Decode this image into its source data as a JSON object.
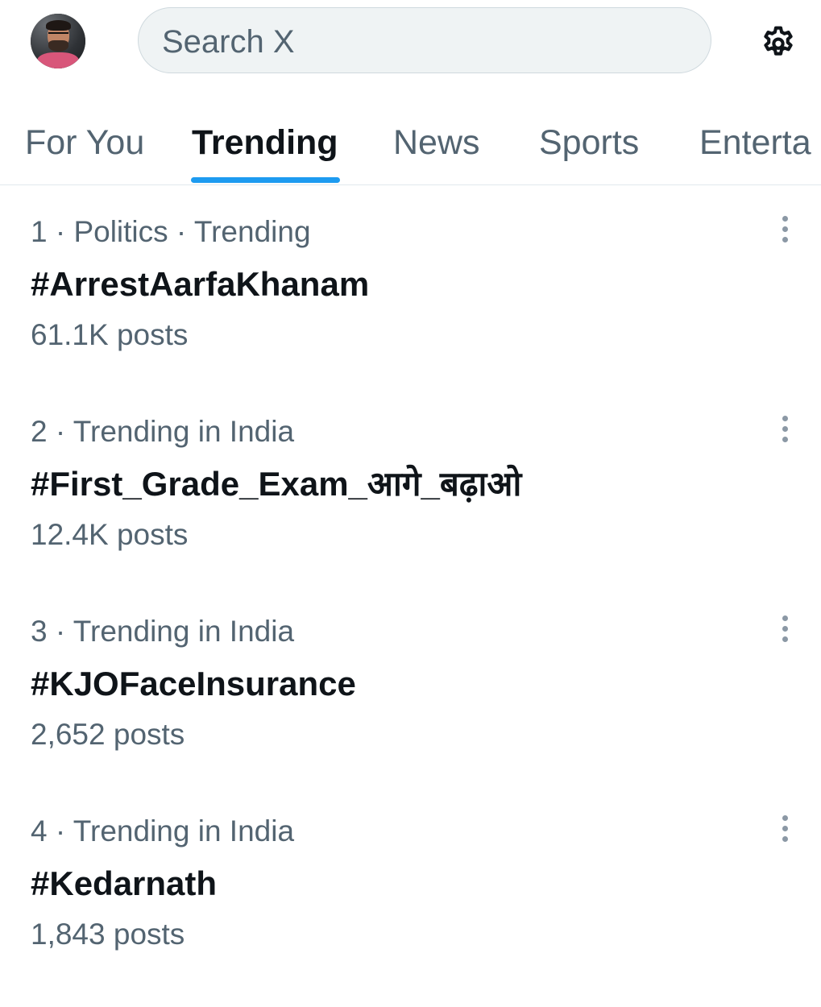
{
  "header": {
    "search_placeholder": "Search X",
    "avatar_icon": "user-avatar",
    "settings_icon": "gear-icon"
  },
  "tabs": [
    {
      "label": "For You",
      "active": false
    },
    {
      "label": "Trending",
      "active": true
    },
    {
      "label": "News",
      "active": false
    },
    {
      "label": "Sports",
      "active": false
    },
    {
      "label": "Enterta",
      "active": false
    }
  ],
  "trends": [
    {
      "meta": "1 · Politics · Trending",
      "name": "#ArrestAarfaKhanam",
      "count": "61.1K posts"
    },
    {
      "meta": "2 · Trending in India",
      "name": "#First_Grade_Exam_आगे_बढ़ाओ",
      "count": "12.4K posts"
    },
    {
      "meta": "3 · Trending in India",
      "name": "#KJOFaceInsurance",
      "count": "2,652 posts"
    },
    {
      "meta": "4 · Trending in India",
      "name": "#Kedarnath",
      "count": "1,843 posts"
    }
  ],
  "colors": {
    "accent": "#1d9bf0",
    "text_primary": "#0f1419",
    "text_secondary": "#536471",
    "search_bg": "#eff3f4"
  }
}
